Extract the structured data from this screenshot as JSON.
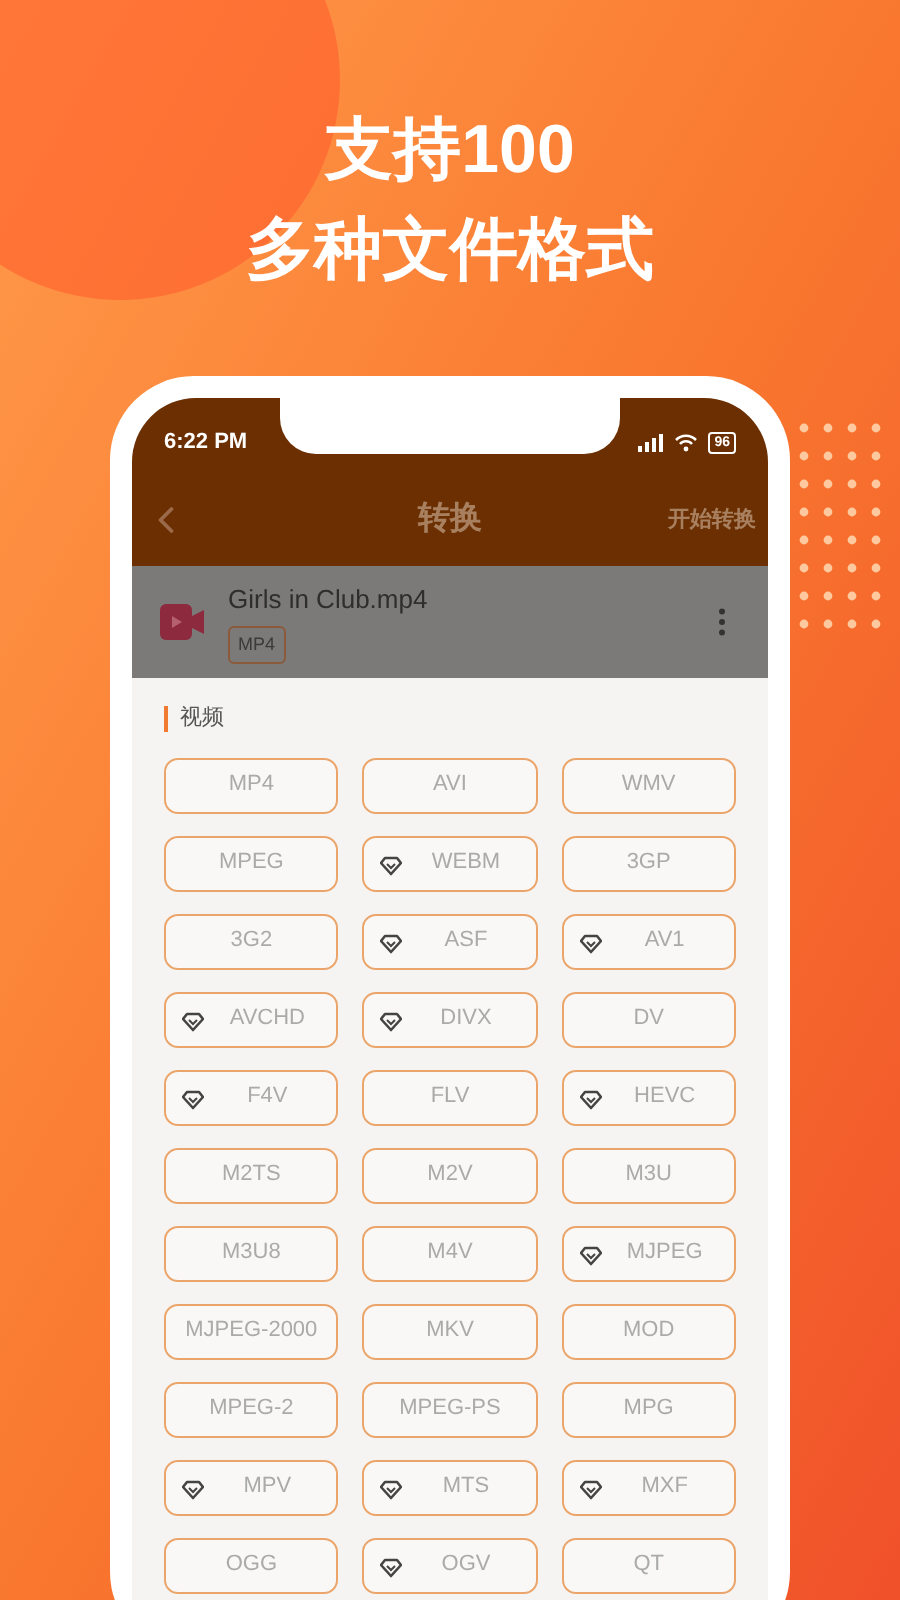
{
  "headline": [
    "支持100",
    "多种文件格式"
  ],
  "status_bar": {
    "time": "6:22 PM",
    "battery": "96"
  },
  "header": {
    "title": "转换",
    "action": "开始转换"
  },
  "file": {
    "name": "Girls in Club.mp4",
    "format": "MP4"
  },
  "section": {
    "title": "视频"
  },
  "formats": [
    {
      "label": "MP4",
      "premium": false
    },
    {
      "label": "AVI",
      "premium": false
    },
    {
      "label": "WMV",
      "premium": false
    },
    {
      "label": "MPEG",
      "premium": false
    },
    {
      "label": "WEBM",
      "premium": true
    },
    {
      "label": "3GP",
      "premium": false
    },
    {
      "label": "3G2",
      "premium": false
    },
    {
      "label": "ASF",
      "premium": true
    },
    {
      "label": "AV1",
      "premium": true
    },
    {
      "label": "AVCHD",
      "premium": true
    },
    {
      "label": "DIVX",
      "premium": true
    },
    {
      "label": "DV",
      "premium": false
    },
    {
      "label": "F4V",
      "premium": true
    },
    {
      "label": "FLV",
      "premium": false
    },
    {
      "label": "HEVC",
      "premium": true
    },
    {
      "label": "M2TS",
      "premium": false
    },
    {
      "label": "M2V",
      "premium": false
    },
    {
      "label": "M3U",
      "premium": false
    },
    {
      "label": "M3U8",
      "premium": false
    },
    {
      "label": "M4V",
      "premium": false
    },
    {
      "label": "MJPEG",
      "premium": true
    },
    {
      "label": "MJPEG-2000",
      "premium": false
    },
    {
      "label": "MKV",
      "premium": false
    },
    {
      "label": "MOD",
      "premium": false
    },
    {
      "label": "MPEG-2",
      "premium": false
    },
    {
      "label": "MPEG-PS",
      "premium": false
    },
    {
      "label": "MPG",
      "premium": false
    },
    {
      "label": "MPV",
      "premium": true
    },
    {
      "label": "MTS",
      "premium": true
    },
    {
      "label": "MXF",
      "premium": true
    },
    {
      "label": "OGG",
      "premium": false
    },
    {
      "label": "OGV",
      "premium": true
    },
    {
      "label": "QT",
      "premium": false
    }
  ]
}
